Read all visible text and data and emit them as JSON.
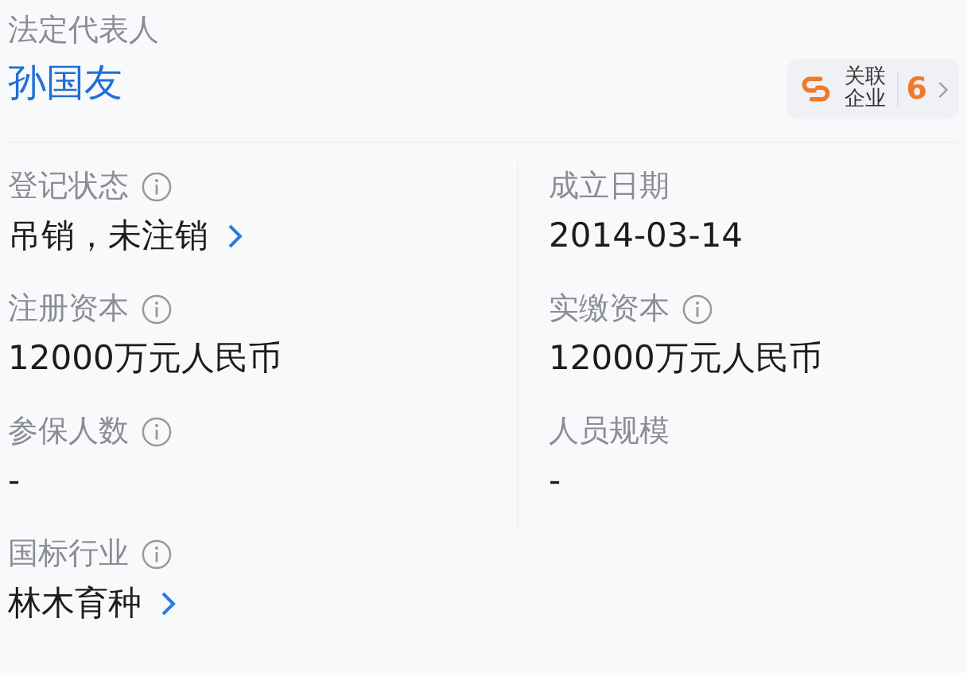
{
  "legal_representative": {
    "label": "法定代表人",
    "name": "孙国友"
  },
  "related_companies": {
    "label_line_1": "关联",
    "label_line_2": "企业",
    "count": "6"
  },
  "fields": [
    {
      "label": "登记状态",
      "info": true,
      "value": "吊销，未注销",
      "link": true
    },
    {
      "label": "成立日期",
      "info": false,
      "value": "2014-03-14",
      "link": false
    },
    {
      "label": "注册资本",
      "info": true,
      "value": "12000万元人民币",
      "link": false
    },
    {
      "label": "实缴资本",
      "info": true,
      "value": "12000万元人民币",
      "link": false
    },
    {
      "label": "参保人数",
      "info": true,
      "value": "-",
      "link": false
    },
    {
      "label": "人员规模",
      "info": false,
      "value": "-",
      "link": false
    },
    {
      "label": "国标行业",
      "info": true,
      "value": "林木育种",
      "link": true
    }
  ]
}
